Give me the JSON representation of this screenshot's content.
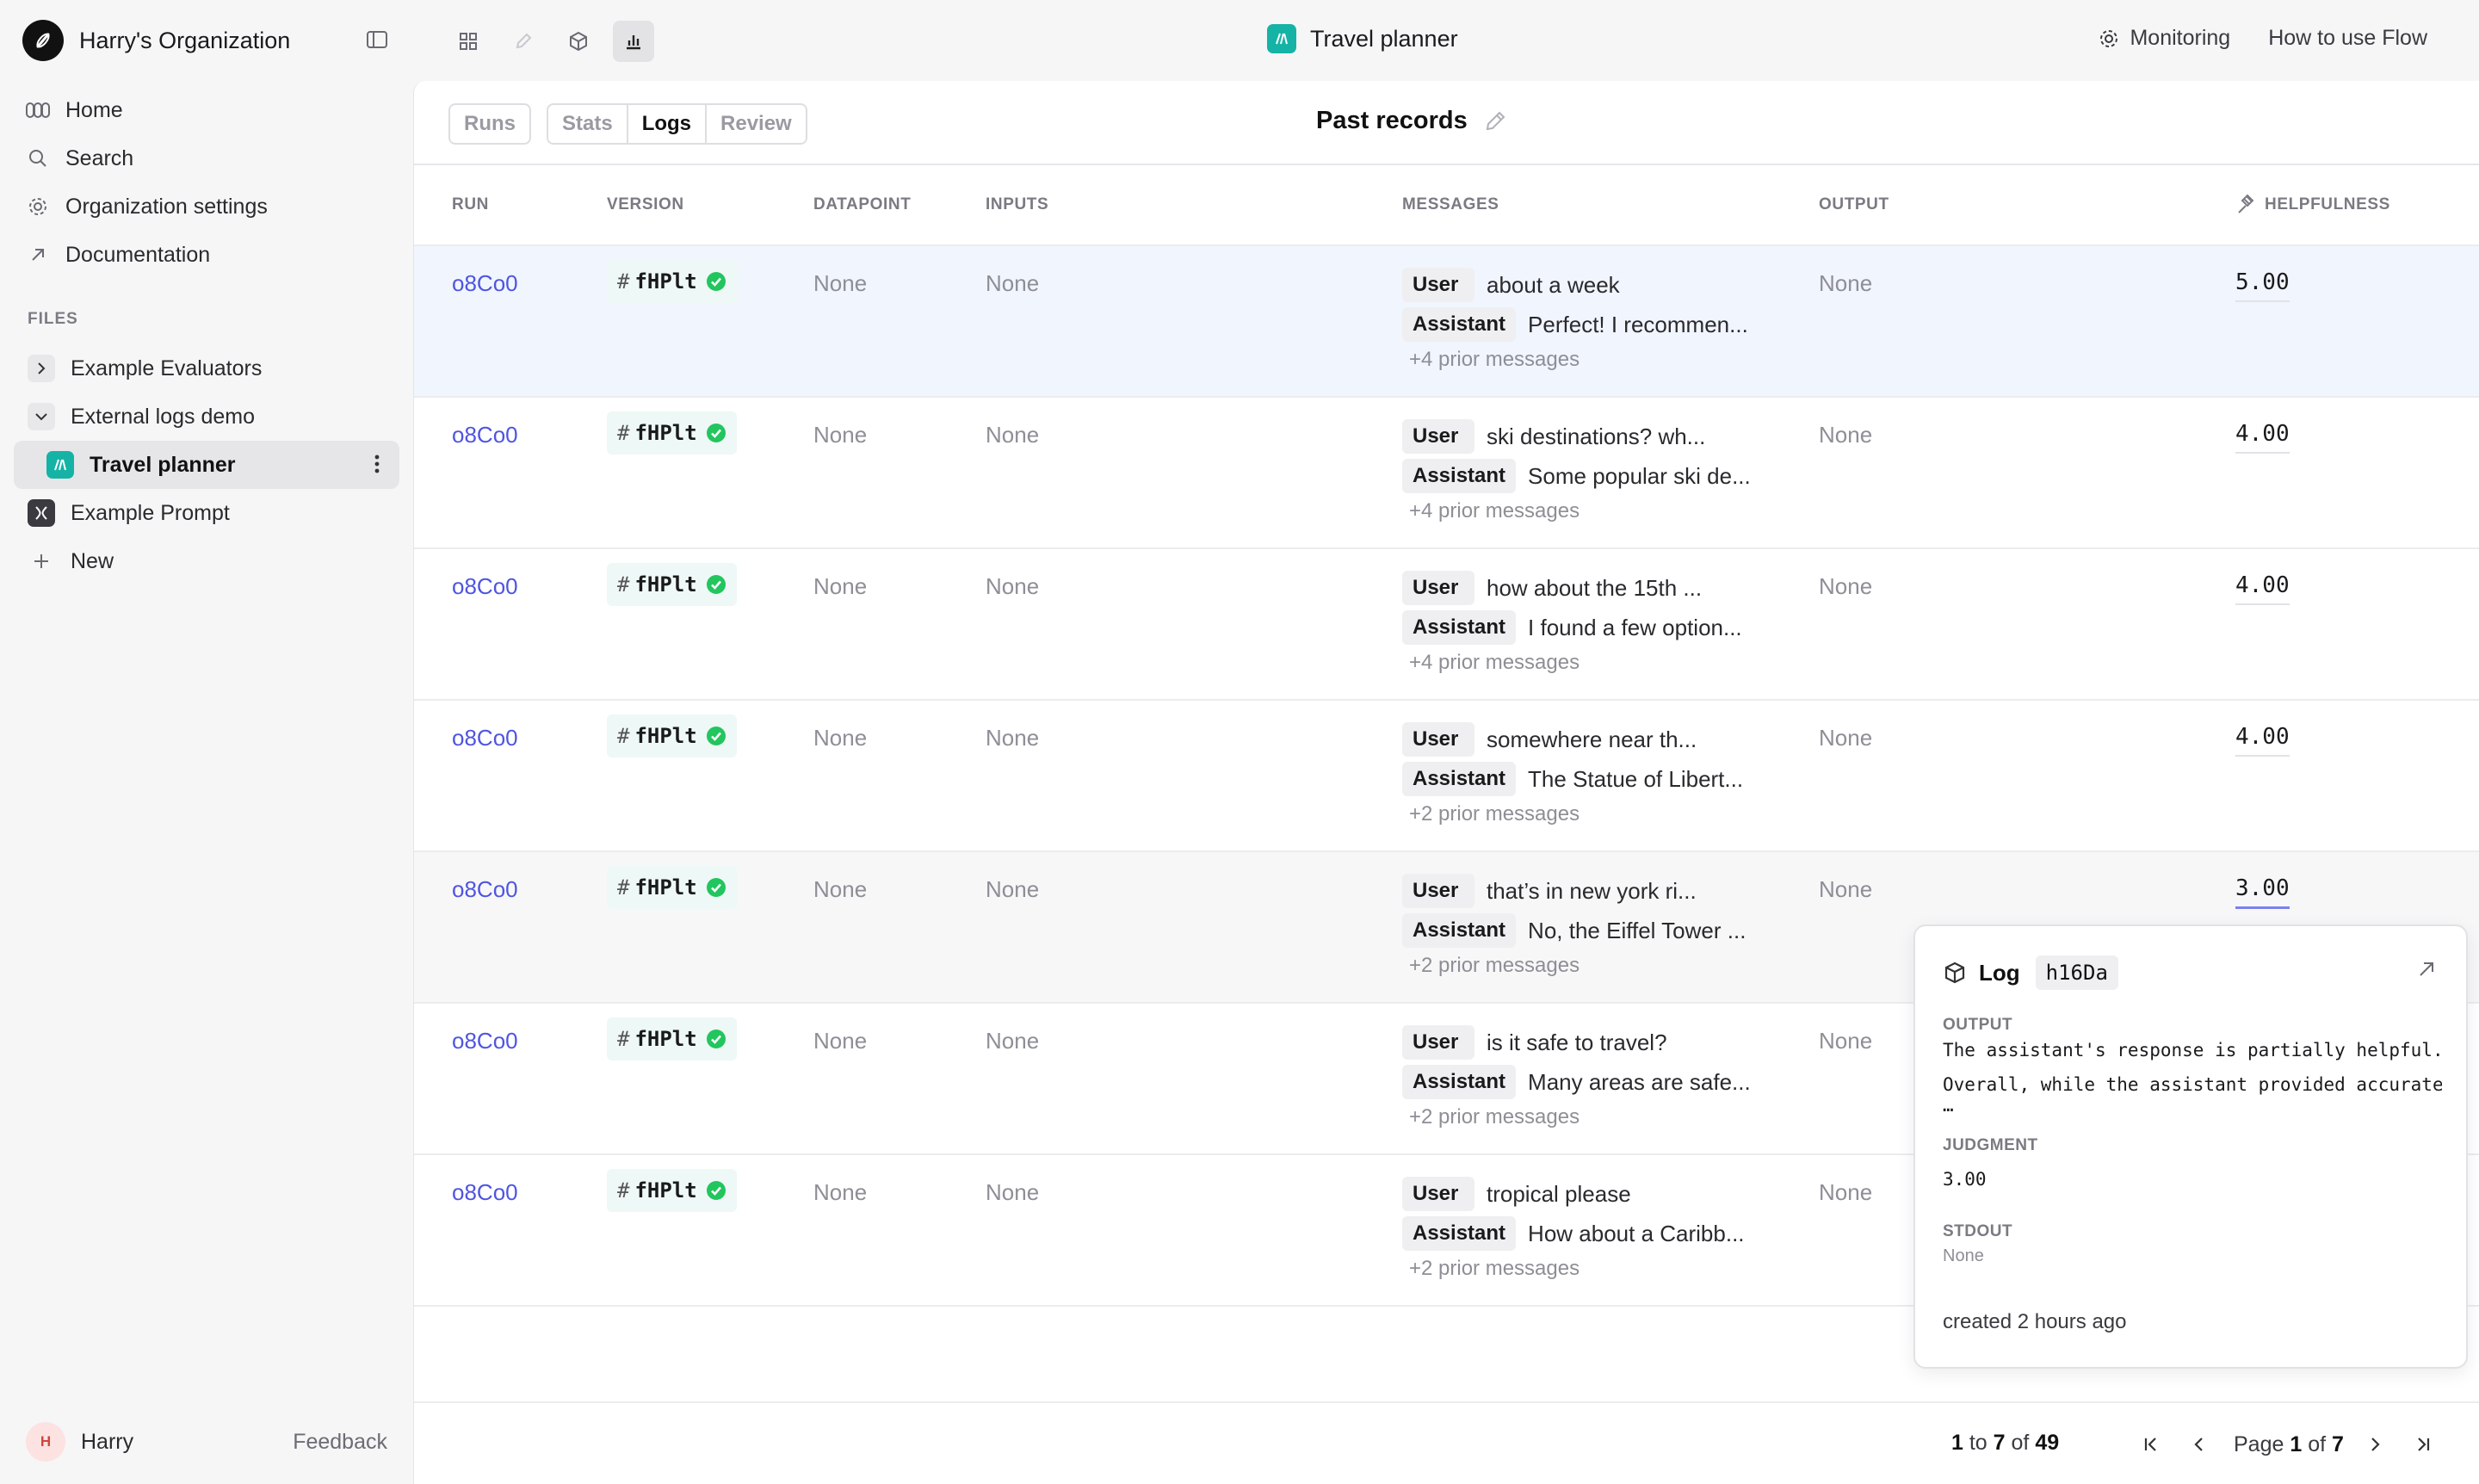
{
  "sidebar": {
    "org_name": "Harry's Organization",
    "nav": [
      {
        "label": "Home",
        "icon": "home-icon"
      },
      {
        "label": "Search",
        "icon": "search-icon"
      },
      {
        "label": "Organization settings",
        "icon": "gear-icon"
      },
      {
        "label": "Documentation",
        "icon": "external-link-icon"
      }
    ],
    "files_label": "FILES",
    "tree": [
      {
        "label": "Example Evaluators",
        "icon": "chevron-right-icon"
      },
      {
        "label": "External logs demo",
        "icon": "chevron-down-icon"
      },
      {
        "label": "Travel planner",
        "icon": "flow-icon"
      },
      {
        "label": "Example Prompt",
        "icon": "prompt-icon"
      },
      {
        "label": "New",
        "icon": "plus-icon"
      }
    ],
    "user": {
      "initial": "H",
      "name": "Harry"
    },
    "feedback": "Feedback"
  },
  "topbar": {
    "title": "Travel planner",
    "monitoring": "Monitoring",
    "how_to": "How to use Flow"
  },
  "tabs": {
    "runs": "Runs",
    "stats": "Stats",
    "logs": "Logs",
    "review": "Review",
    "active": "Logs"
  },
  "page_title": "Past records",
  "table": {
    "headers": [
      "RUN",
      "VERSION",
      "DATAPOINT",
      "INPUTS",
      "MESSAGES",
      "OUTPUT",
      "HELPFULNESS"
    ],
    "rows": [
      {
        "run": "o8Co0",
        "version": "fHPlt",
        "datapoint": "None",
        "inputs": "None",
        "user": "about a week",
        "assistant": "Perfect! I recommen...",
        "prior": "+4 prior messages",
        "output": "None",
        "score": "5.00"
      },
      {
        "run": "o8Co0",
        "version": "fHPlt",
        "datapoint": "None",
        "inputs": "None",
        "user": "ski destinations? wh...",
        "assistant": "Some popular ski de...",
        "prior": "+4 prior messages",
        "output": "None",
        "score": "4.00"
      },
      {
        "run": "o8Co0",
        "version": "fHPlt",
        "datapoint": "None",
        "inputs": "None",
        "user": "how about the 15th ...",
        "assistant": "I found a few option...",
        "prior": "+4 prior messages",
        "output": "None",
        "score": "4.00"
      },
      {
        "run": "o8Co0",
        "version": "fHPlt",
        "datapoint": "None",
        "inputs": "None",
        "user": "somewhere near th...",
        "assistant": "The Statue of Libert...",
        "prior": "+2 prior messages",
        "output": "None",
        "score": "4.00"
      },
      {
        "run": "o8Co0",
        "version": "fHPlt",
        "datapoint": "None",
        "inputs": "None",
        "user": "that’s in new york ri...",
        "assistant": "No, the Eiffel Tower ...",
        "prior": "+2 prior messages",
        "output": "None",
        "score": "3.00"
      },
      {
        "run": "o8Co0",
        "version": "fHPlt",
        "datapoint": "None",
        "inputs": "None",
        "user": "is it safe to travel?",
        "assistant": "Many areas are safe...",
        "prior": "+2 prior messages",
        "output": "None",
        "score": ""
      },
      {
        "run": "o8Co0",
        "version": "fHPlt",
        "datapoint": "None",
        "inputs": "None",
        "user": "tropical please",
        "assistant": "How about a Caribb...",
        "prior": "+2 prior messages",
        "output": "None",
        "score": ""
      }
    ],
    "role_user": "User",
    "role_assistant": "Assistant"
  },
  "popover": {
    "title": "Log",
    "id": "h16Da",
    "output_label": "OUTPUT",
    "output_line1": "The assistant's response is partially helpful. I",
    "output_line2": "Overall, while the assistant provided accurate i",
    "output_line3": "…",
    "judgment_label": "JUDGMENT",
    "judgment": "3.00",
    "stdout_label": "STDOUT",
    "stdout": "None",
    "created": "created 2 hours ago"
  },
  "pagination": {
    "from": "1",
    "to_word": "to",
    "to": "7",
    "of_word": "of",
    "total": "49",
    "page_word": "Page",
    "page": "1",
    "pages": "7"
  },
  "colors": {
    "accent": "#4f55e0",
    "flow_badge": "#15b3a6",
    "check": "#22c55e"
  }
}
